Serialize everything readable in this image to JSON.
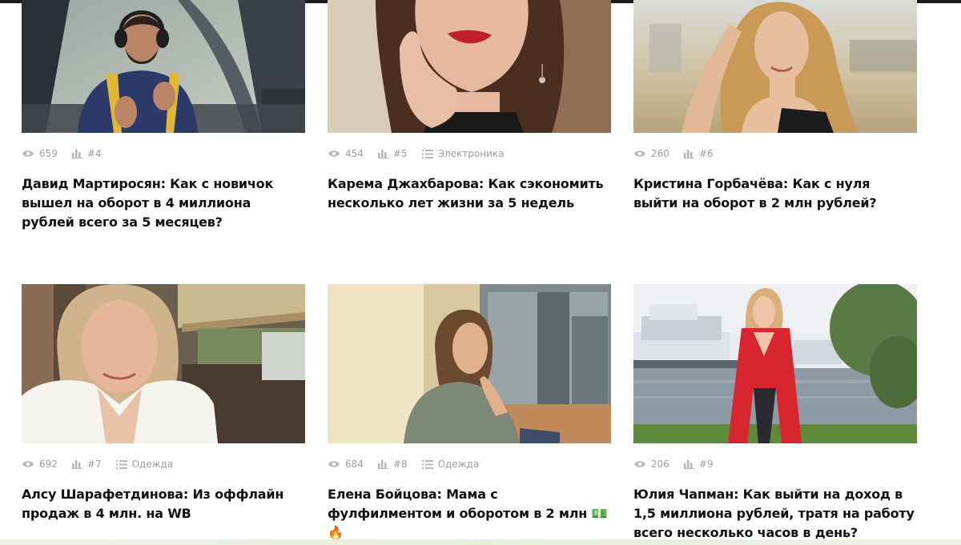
{
  "cards": [
    {
      "views": "659",
      "rank": "#4",
      "category": "",
      "title": "Давид Мартиросян: Как с новичок вышел на оборот в 4 миллиона рублей всего за 5 месяцев?"
    },
    {
      "views": "454",
      "rank": "#5",
      "category": "Электроника",
      "title": "Карема Джахбарова: Как сэкономить несколько лет жизни за 5 недель"
    },
    {
      "views": "260",
      "rank": "#6",
      "category": "",
      "title": "Кристина Горбачёва: Как с нуля выйти на оборот в 2 млн рублей?"
    },
    {
      "views": "692",
      "rank": "#7",
      "category": "Одежда",
      "title": "Алсу Шарафетдинова: Из оффлайн продаж в 4 млн. на WB"
    },
    {
      "views": "684",
      "rank": "#8",
      "category": "Одежда",
      "title": "Елена Бойцова: Мама с фулфилментом и оборотом в 2 млн",
      "emoji": "💵🔥"
    },
    {
      "views": "206",
      "rank": "#9",
      "category": "",
      "title": "Юлия Чапман: Как выйти на доход в 1,5 миллиона рублей, тратя на работу всего несколько часов в день?"
    }
  ],
  "icons": {
    "views": "eye-icon",
    "rank": "bar-chart-icon",
    "category": "list-icon"
  },
  "colors": {
    "meta_text": "#9a9ea6",
    "title_text": "#111111",
    "top_bar": "#1c1c1c"
  }
}
